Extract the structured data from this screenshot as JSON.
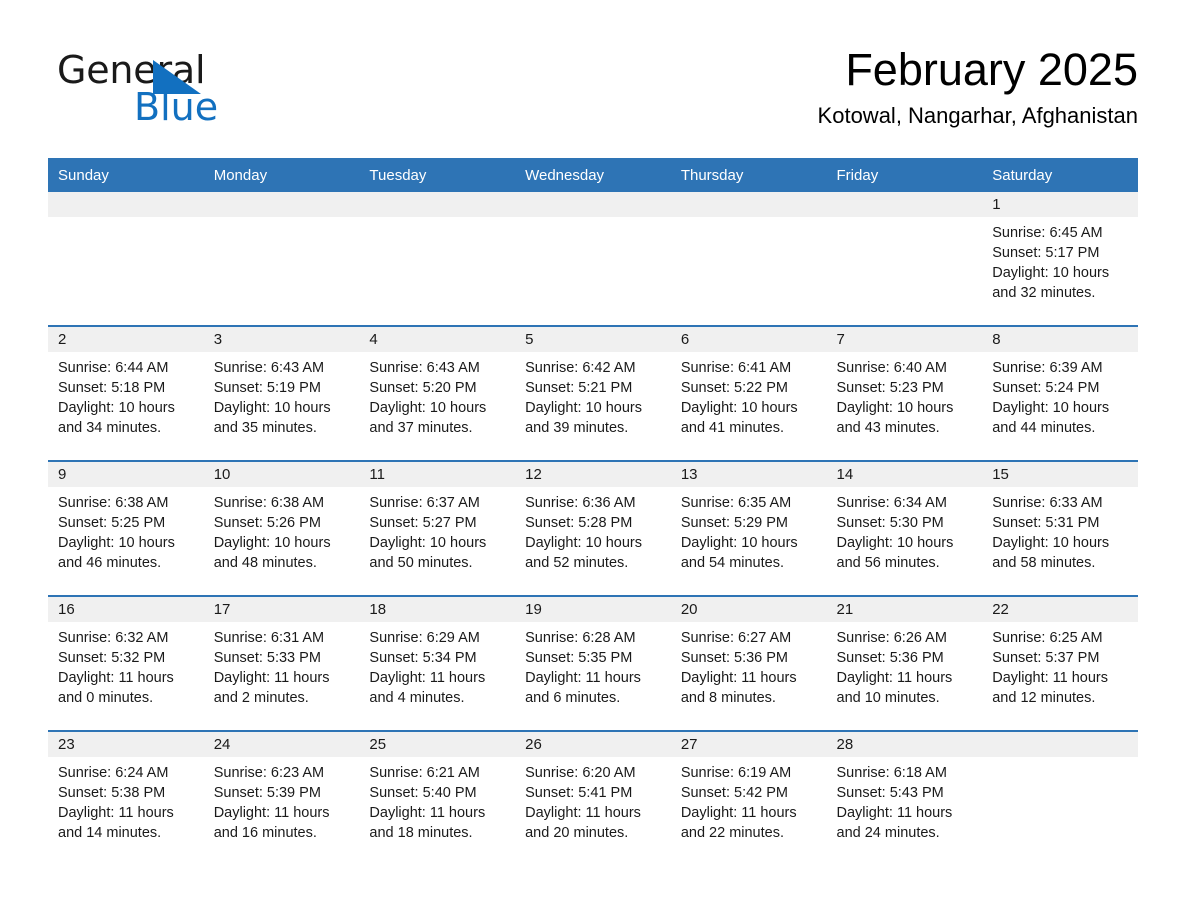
{
  "brand": {
    "line1": "General",
    "line2": "Blue",
    "mark": "triangle-logo-mark",
    "accent_color": "#1270c0"
  },
  "header": {
    "month_title": "February 2025",
    "location": "Kotowal, Nangarhar, Afghanistan"
  },
  "theme": {
    "header_blue": "#2e74b5",
    "daynum_band_gray": "#f0f0f0",
    "text_color": "#1a1a1a"
  },
  "calendar": {
    "weekday_headers": [
      "Sunday",
      "Monday",
      "Tuesday",
      "Wednesday",
      "Thursday",
      "Friday",
      "Saturday"
    ],
    "weeks": [
      [
        {
          "day": "",
          "lines": []
        },
        {
          "day": "",
          "lines": []
        },
        {
          "day": "",
          "lines": []
        },
        {
          "day": "",
          "lines": []
        },
        {
          "day": "",
          "lines": []
        },
        {
          "day": "",
          "lines": []
        },
        {
          "day": "1",
          "lines": [
            "Sunrise: 6:45 AM",
            "Sunset: 5:17 PM",
            "Daylight: 10 hours",
            "and 32 minutes."
          ]
        }
      ],
      [
        {
          "day": "2",
          "lines": [
            "Sunrise: 6:44 AM",
            "Sunset: 5:18 PM",
            "Daylight: 10 hours",
            "and 34 minutes."
          ]
        },
        {
          "day": "3",
          "lines": [
            "Sunrise: 6:43 AM",
            "Sunset: 5:19 PM",
            "Daylight: 10 hours",
            "and 35 minutes."
          ]
        },
        {
          "day": "4",
          "lines": [
            "Sunrise: 6:43 AM",
            "Sunset: 5:20 PM",
            "Daylight: 10 hours",
            "and 37 minutes."
          ]
        },
        {
          "day": "5",
          "lines": [
            "Sunrise: 6:42 AM",
            "Sunset: 5:21 PM",
            "Daylight: 10 hours",
            "and 39 minutes."
          ]
        },
        {
          "day": "6",
          "lines": [
            "Sunrise: 6:41 AM",
            "Sunset: 5:22 PM",
            "Daylight: 10 hours",
            "and 41 minutes."
          ]
        },
        {
          "day": "7",
          "lines": [
            "Sunrise: 6:40 AM",
            "Sunset: 5:23 PM",
            "Daylight: 10 hours",
            "and 43 minutes."
          ]
        },
        {
          "day": "8",
          "lines": [
            "Sunrise: 6:39 AM",
            "Sunset: 5:24 PM",
            "Daylight: 10 hours",
            "and 44 minutes."
          ]
        }
      ],
      [
        {
          "day": "9",
          "lines": [
            "Sunrise: 6:38 AM",
            "Sunset: 5:25 PM",
            "Daylight: 10 hours",
            "and 46 minutes."
          ]
        },
        {
          "day": "10",
          "lines": [
            "Sunrise: 6:38 AM",
            "Sunset: 5:26 PM",
            "Daylight: 10 hours",
            "and 48 minutes."
          ]
        },
        {
          "day": "11",
          "lines": [
            "Sunrise: 6:37 AM",
            "Sunset: 5:27 PM",
            "Daylight: 10 hours",
            "and 50 minutes."
          ]
        },
        {
          "day": "12",
          "lines": [
            "Sunrise: 6:36 AM",
            "Sunset: 5:28 PM",
            "Daylight: 10 hours",
            "and 52 minutes."
          ]
        },
        {
          "day": "13",
          "lines": [
            "Sunrise: 6:35 AM",
            "Sunset: 5:29 PM",
            "Daylight: 10 hours",
            "and 54 minutes."
          ]
        },
        {
          "day": "14",
          "lines": [
            "Sunrise: 6:34 AM",
            "Sunset: 5:30 PM",
            "Daylight: 10 hours",
            "and 56 minutes."
          ]
        },
        {
          "day": "15",
          "lines": [
            "Sunrise: 6:33 AM",
            "Sunset: 5:31 PM",
            "Daylight: 10 hours",
            "and 58 minutes."
          ]
        }
      ],
      [
        {
          "day": "16",
          "lines": [
            "Sunrise: 6:32 AM",
            "Sunset: 5:32 PM",
            "Daylight: 11 hours",
            "and 0 minutes."
          ]
        },
        {
          "day": "17",
          "lines": [
            "Sunrise: 6:31 AM",
            "Sunset: 5:33 PM",
            "Daylight: 11 hours",
            "and 2 minutes."
          ]
        },
        {
          "day": "18",
          "lines": [
            "Sunrise: 6:29 AM",
            "Sunset: 5:34 PM",
            "Daylight: 11 hours",
            "and 4 minutes."
          ]
        },
        {
          "day": "19",
          "lines": [
            "Sunrise: 6:28 AM",
            "Sunset: 5:35 PM",
            "Daylight: 11 hours",
            "and 6 minutes."
          ]
        },
        {
          "day": "20",
          "lines": [
            "Sunrise: 6:27 AM",
            "Sunset: 5:36 PM",
            "Daylight: 11 hours",
            "and 8 minutes."
          ]
        },
        {
          "day": "21",
          "lines": [
            "Sunrise: 6:26 AM",
            "Sunset: 5:36 PM",
            "Daylight: 11 hours",
            "and 10 minutes."
          ]
        },
        {
          "day": "22",
          "lines": [
            "Sunrise: 6:25 AM",
            "Sunset: 5:37 PM",
            "Daylight: 11 hours",
            "and 12 minutes."
          ]
        }
      ],
      [
        {
          "day": "23",
          "lines": [
            "Sunrise: 6:24 AM",
            "Sunset: 5:38 PM",
            "Daylight: 11 hours",
            "and 14 minutes."
          ]
        },
        {
          "day": "24",
          "lines": [
            "Sunrise: 6:23 AM",
            "Sunset: 5:39 PM",
            "Daylight: 11 hours",
            "and 16 minutes."
          ]
        },
        {
          "day": "25",
          "lines": [
            "Sunrise: 6:21 AM",
            "Sunset: 5:40 PM",
            "Daylight: 11 hours",
            "and 18 minutes."
          ]
        },
        {
          "day": "26",
          "lines": [
            "Sunrise: 6:20 AM",
            "Sunset: 5:41 PM",
            "Daylight: 11 hours",
            "and 20 minutes."
          ]
        },
        {
          "day": "27",
          "lines": [
            "Sunrise: 6:19 AM",
            "Sunset: 5:42 PM",
            "Daylight: 11 hours",
            "and 22 minutes."
          ]
        },
        {
          "day": "28",
          "lines": [
            "Sunrise: 6:18 AM",
            "Sunset: 5:43 PM",
            "Daylight: 11 hours",
            "and 24 minutes."
          ]
        },
        {
          "day": "",
          "lines": []
        }
      ]
    ]
  }
}
